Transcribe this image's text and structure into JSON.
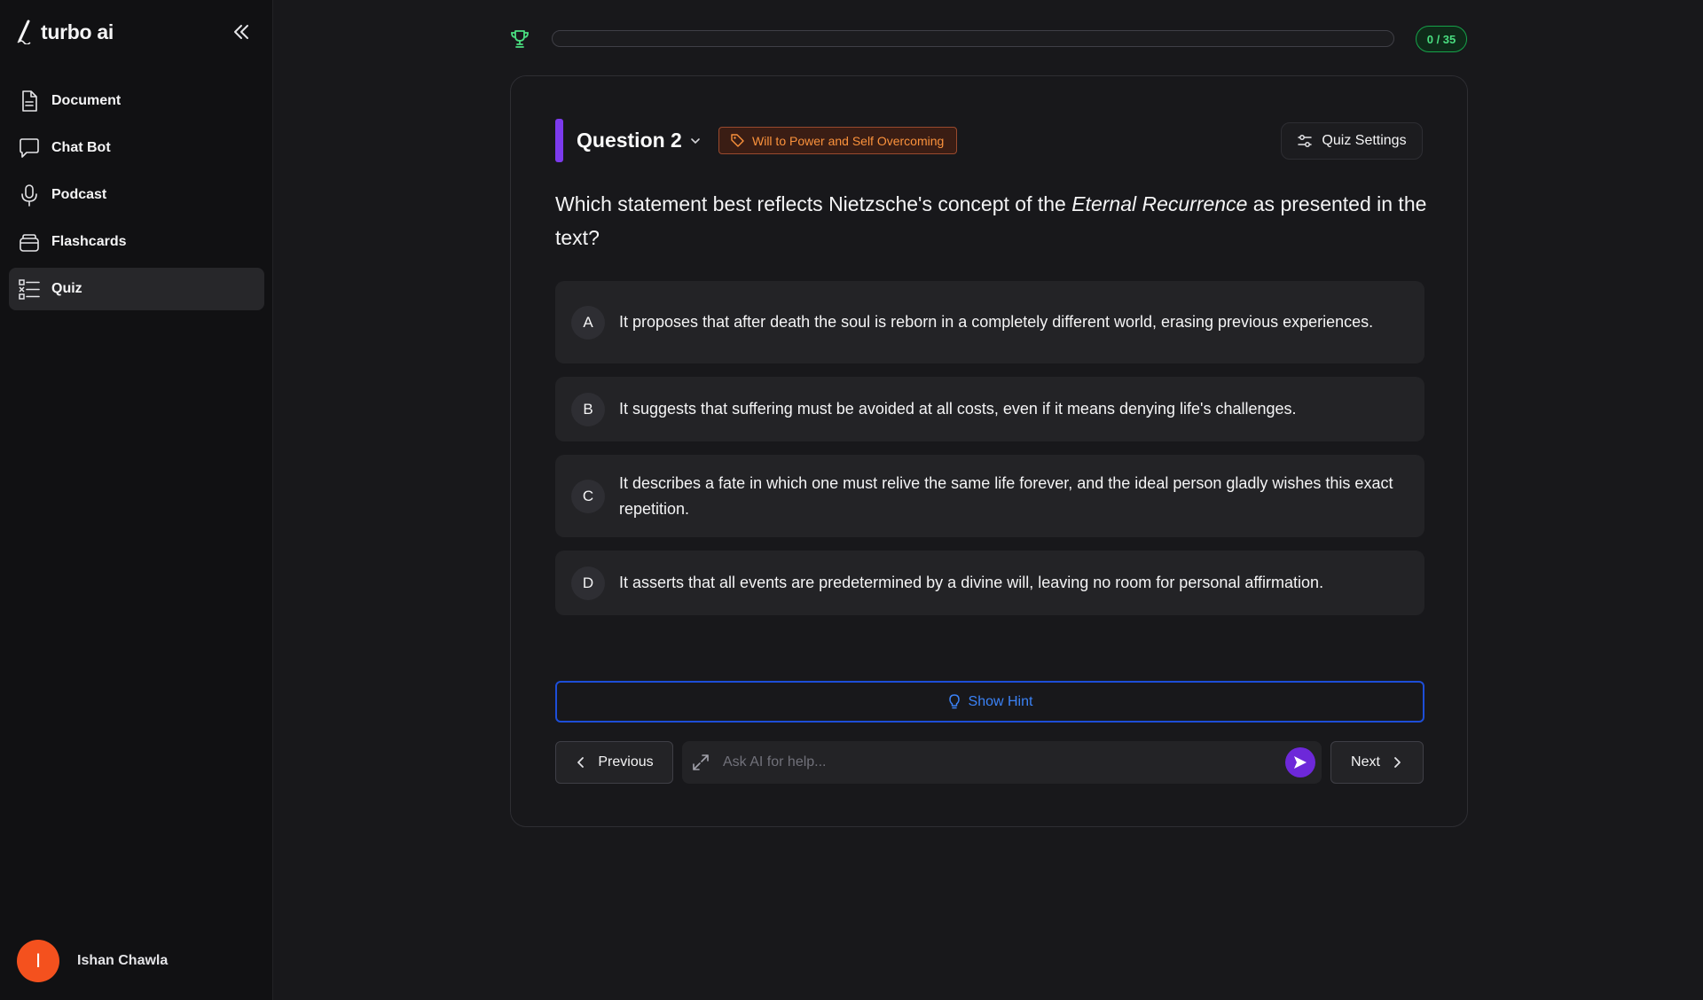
{
  "app": {
    "name": "turbo ai"
  },
  "sidebar": {
    "items": [
      {
        "label": "Document",
        "icon": "document-icon"
      },
      {
        "label": "Chat Bot",
        "icon": "chat-bubble-icon"
      },
      {
        "label": "Podcast",
        "icon": "microphone-icon"
      },
      {
        "label": "Flashcards",
        "icon": "flashcards-icon"
      },
      {
        "label": "Quiz",
        "icon": "quiz-list-icon",
        "active": true
      }
    ],
    "user": {
      "name": "Ishan Chawla",
      "initial": "I",
      "avatar_color": "#f4511e"
    }
  },
  "progress": {
    "label": "0 / 35",
    "answered": 0,
    "total": 35,
    "fraction": 0
  },
  "quiz": {
    "question_title": "Question 2",
    "topic_tag": "Will to Power and Self Overcoming",
    "settings_label": "Quiz Settings",
    "question_before": "Which statement best reflects Nietzsche's concept of the ",
    "question_emphasis": "Eternal Recurrence",
    "question_after": " as presented in the text?",
    "options": [
      {
        "letter": "A",
        "text": "It proposes that after death the soul is reborn in a completely different world, erasing previous experiences."
      },
      {
        "letter": "B",
        "text": "It suggests that suffering must be avoided at all costs, even if it means denying life's challenges."
      },
      {
        "letter": "C",
        "text": "It describes a fate in which one must relive the same life forever, and the ideal person gladly wishes this exact repetition."
      },
      {
        "letter": "D",
        "text": "It asserts that all events are predetermined by a divine will, leaving no room for personal affirmation."
      }
    ],
    "hint_label": "Show Hint",
    "previous_label": "Previous",
    "next_label": "Next",
    "ai_input": {
      "placeholder": "Ask AI for help...",
      "value": ""
    }
  },
  "colors": {
    "accent_purple": "#7c3aed",
    "progress_green": "#22c55e",
    "tag_orange": "#fb923c",
    "hint_blue": "#3b82f6"
  }
}
